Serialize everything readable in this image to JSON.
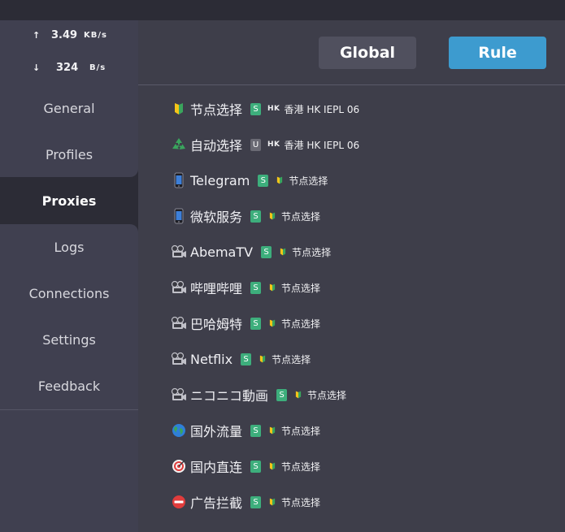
{
  "speed": {
    "upload_value": "3.49",
    "upload_unit": "KB/s",
    "download_value": "324",
    "download_unit": "B/s"
  },
  "nav": {
    "general": "General",
    "profiles": "Profiles",
    "proxies": "Proxies",
    "logs": "Logs",
    "connections": "Connections",
    "settings": "Settings",
    "feedback": "Feedback"
  },
  "mode": {
    "global": "Global",
    "rule": "Rule",
    "active": "Rule"
  },
  "proxies": [
    {
      "name": "节点选择",
      "icon": "beginner-icon",
      "badge": "S",
      "flag": "HK",
      "selected": "香港 HK IEPL 06"
    },
    {
      "name": "自动选择",
      "icon": "recycle-icon",
      "badge": "U",
      "flag": "HK",
      "selected": "香港 HK IEPL 06"
    },
    {
      "name": "Telegram",
      "icon": "phone-icon",
      "badge": "S",
      "selected": "节点选择"
    },
    {
      "name": "微软服务",
      "icon": "phone-icon",
      "badge": "S",
      "selected": "节点选择"
    },
    {
      "name": "AbemaTV",
      "icon": "video-camera-icon",
      "badge": "S",
      "selected": "节点选择"
    },
    {
      "name": "哔哩哔哩",
      "icon": "video-camera-icon",
      "badge": "S",
      "selected": "节点选择"
    },
    {
      "name": "巴哈姆特",
      "icon": "video-camera-icon",
      "badge": "S",
      "selected": "节点选择"
    },
    {
      "name": "Netflix",
      "icon": "video-camera-icon",
      "badge": "S",
      "selected": "节点选择"
    },
    {
      "name": "ニコニコ動画",
      "icon": "video-camera-icon",
      "badge": "S",
      "selected": "节点选择"
    },
    {
      "name": "国外流量",
      "icon": "globe-icon",
      "badge": "S",
      "selected": "节点选择"
    },
    {
      "name": "国内直连",
      "icon": "target-icon",
      "badge": "S",
      "selected": "节点选择"
    },
    {
      "name": "广告拦截",
      "icon": "no-entry-icon",
      "badge": "S",
      "selected": "节点选择"
    }
  ],
  "colors": {
    "rule_button": "#3d9bcf",
    "badge_s": "#3dae7c",
    "badge_u": "#6a6a74"
  }
}
